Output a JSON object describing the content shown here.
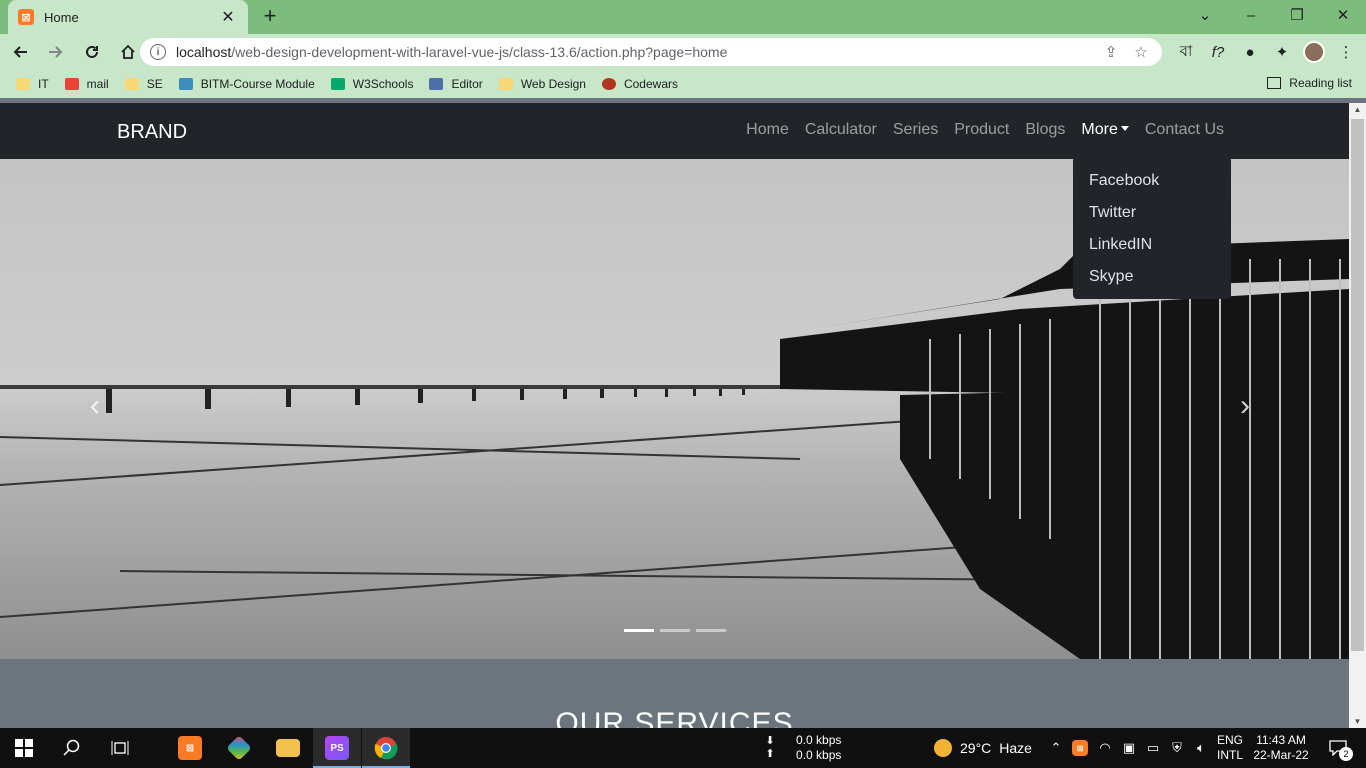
{
  "browser": {
    "tab_title": "Home",
    "tab_close": "✕",
    "new_tab": "+",
    "window_controls": {
      "tab_search": "⌄",
      "minimize": "–",
      "restore": "❐",
      "close": "✕"
    },
    "url_host": "localhost",
    "url_path": "/web-design-development-with-laravel-vue-js/class-13.6/action.php?page=home",
    "bookmarks": [
      "IT",
      "mail",
      "SE",
      "BITM-Course Module",
      "W3Schools",
      "Editor",
      "Web Design",
      "Codewars"
    ],
    "reading_list": "Reading list"
  },
  "site": {
    "brand": "BRAND",
    "nav": [
      "Home",
      "Calculator",
      "Series",
      "Product",
      "Blogs",
      "More",
      "Contact Us"
    ],
    "dropdown": [
      "Facebook",
      "Twitter",
      "LinkedIN",
      "Skype"
    ],
    "carousel_indicators": 3,
    "carousel_active": 0,
    "services_title": "OUR SERVICES"
  },
  "taskbar": {
    "net_down": "0.0 kbps",
    "net_up": "0.0 kbps",
    "temperature": "29°C",
    "weather": "Haze",
    "lang": "ENG",
    "layout": "INTL",
    "time": "11:43 AM",
    "date": "22-Mar-22",
    "notification_count": "2"
  },
  "colors": {
    "chrome_frame": "#7cbd7d",
    "chrome_toolbar": "#c8e6c8",
    "navbar": "#212529",
    "section": "#6c757d",
    "taskbar": "#101010"
  }
}
